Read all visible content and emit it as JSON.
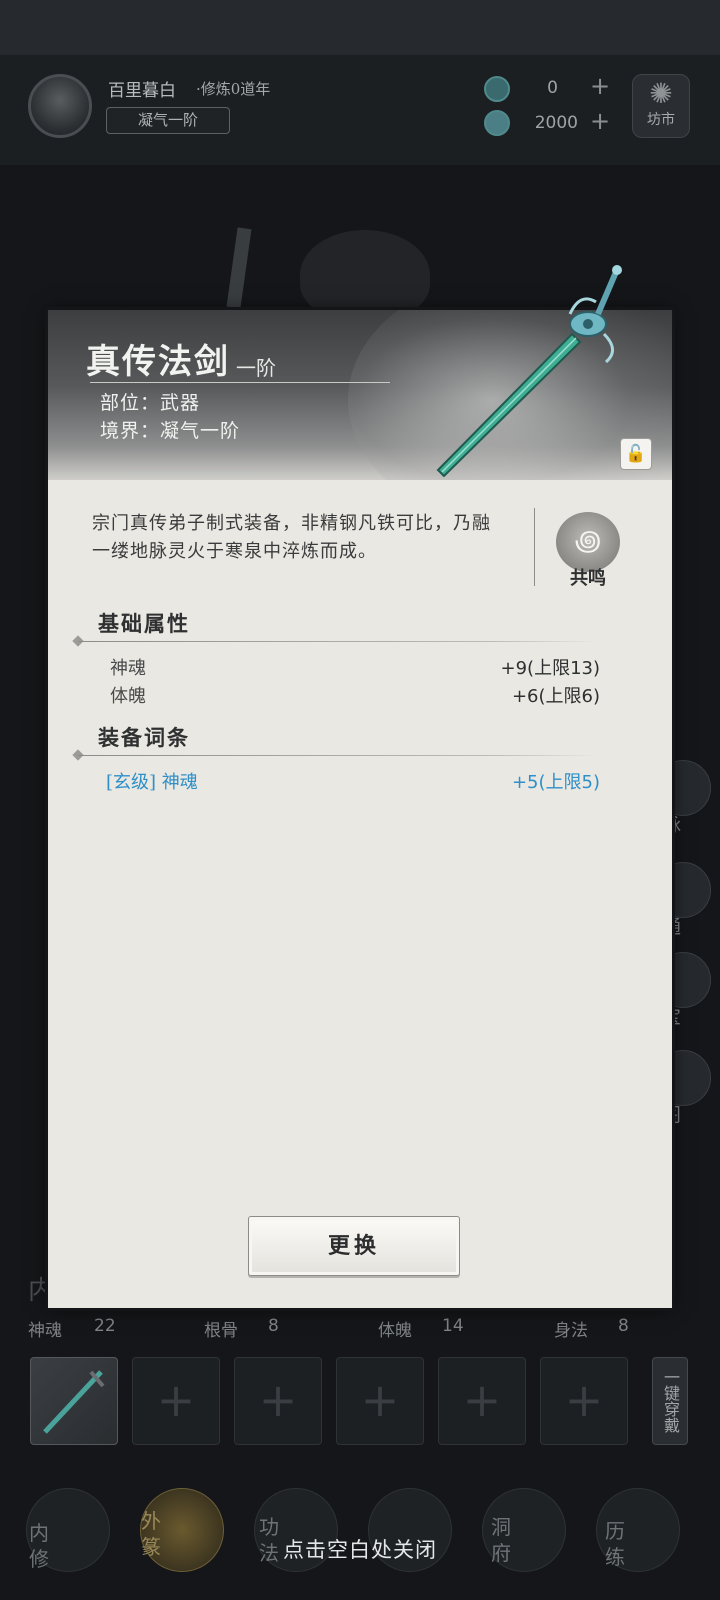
{
  "player": {
    "name": "百里暮白",
    "cultivation": "·修炼0道年",
    "realm": "凝气一阶"
  },
  "resources": [
    {
      "icon": "jade-ring-icon",
      "value": "0"
    },
    {
      "icon": "spirit-stone-icon",
      "value": "2000"
    }
  ],
  "market": {
    "label": "坊市",
    "icon": "market-icon"
  },
  "side_buttons": [
    "脉",
    "通",
    "宝",
    "阁"
  ],
  "stats": [
    {
      "label": "神魂",
      "value": "22"
    },
    {
      "label": "根骨",
      "value": "8"
    },
    {
      "label": "体魄",
      "value": "14"
    },
    {
      "label": "身法",
      "value": "8"
    }
  ],
  "section_partial": "内",
  "equip_all_label": "一键穿戴",
  "bottom_nav": [
    "内修",
    "外篆",
    "功法",
    "",
    "洞府",
    "历练"
  ],
  "close_hint": "点击空白处关闭",
  "item": {
    "name": "真传法剑",
    "grade": "一阶",
    "slot_label": "部位：",
    "slot": "武器",
    "realm_label": "境界：",
    "realm": "凝气一阶",
    "description": "宗门真传弟子制式装备，非精钢凡铁可比，乃融一缕地脉灵火于寒泉中淬炼而成。",
    "resonate_label": "共鸣",
    "base_title": "基础属性",
    "base_attrs": [
      {
        "name": "神魂",
        "value": "+9(上限13)"
      },
      {
        "name": "体魄",
        "value": "+6(上限6)"
      }
    ],
    "affix_title": "装备词条",
    "affixes": [
      {
        "name": "[玄级] 神魂",
        "value": "+5(上限5)"
      }
    ],
    "replace_label": "更换"
  }
}
